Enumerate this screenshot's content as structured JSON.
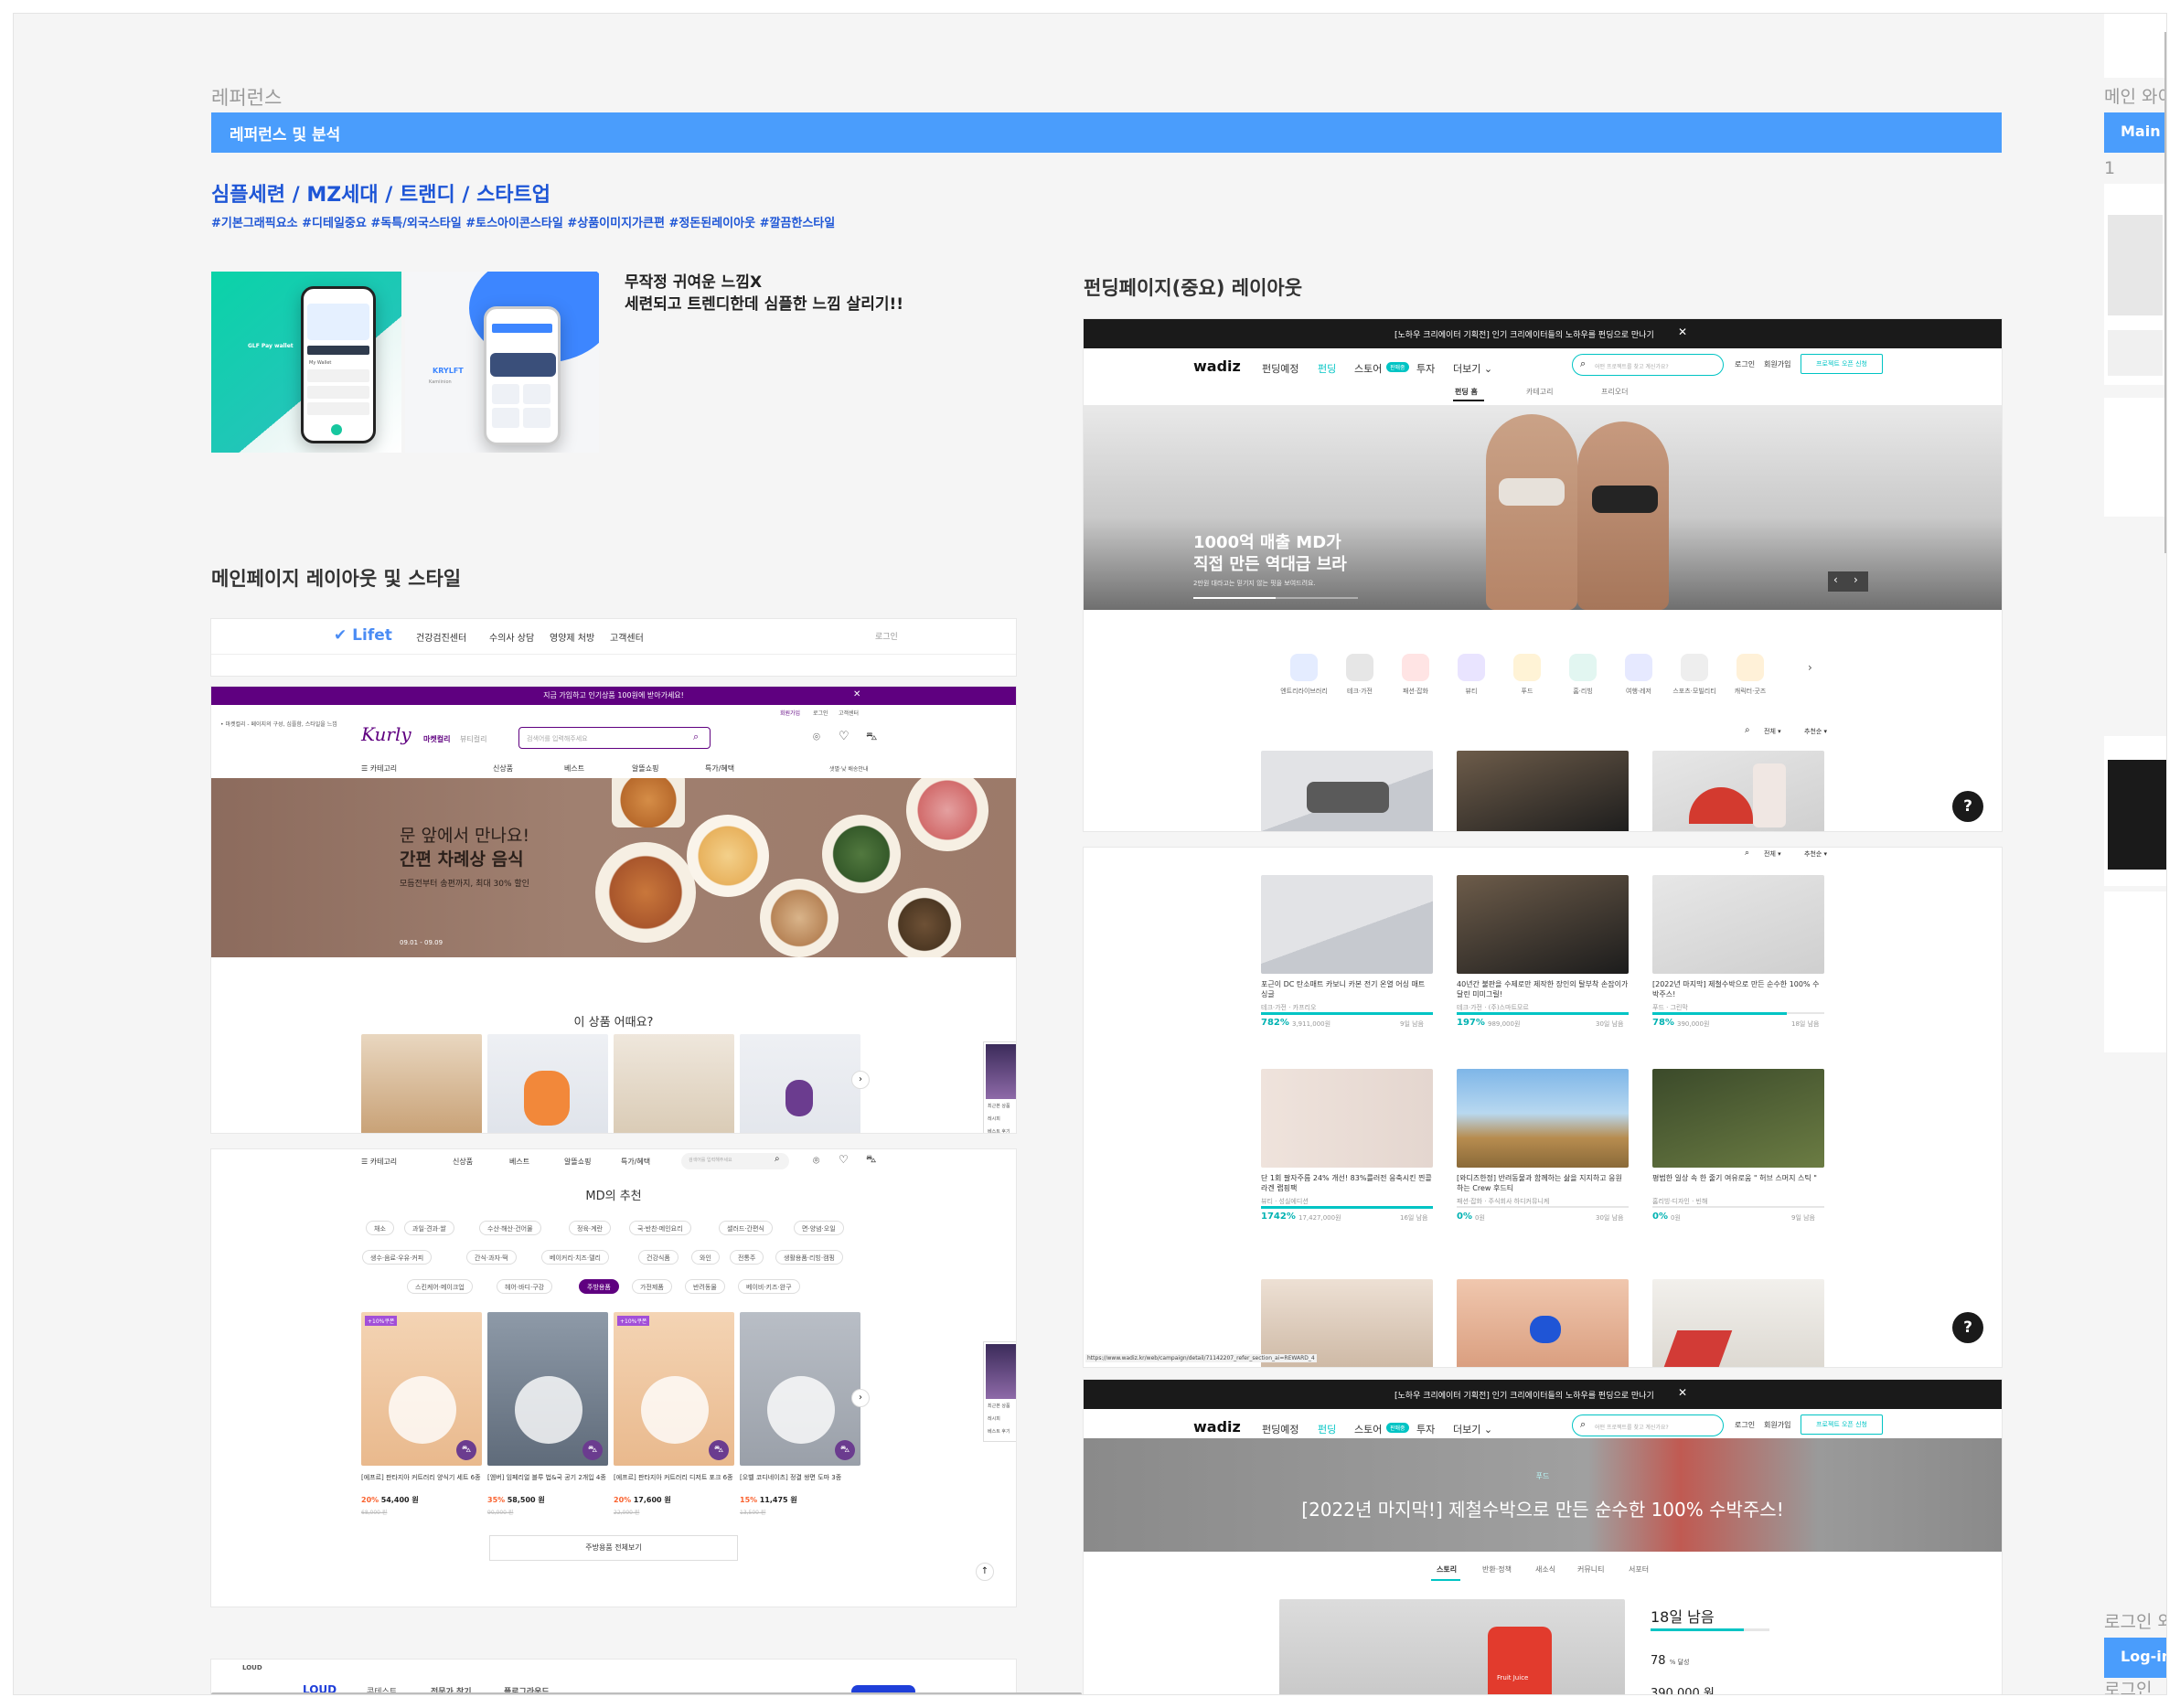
{
  "section": {
    "title_small": "레퍼런스",
    "header_bar_label": "레퍼런스 및 분석",
    "keywords": "심플세련 / MZ세대 / 트랜디 / 스타트업",
    "hashtags": "#기본그래픽요소 #디테일중요 #독특/외국스타일 #토스아이콘스타일 #상품이미지가큰편 #정돈된레이아웃 #깔끔한스타일",
    "note_line1": "무작정 귀여운 느낌X",
    "note_line2": "세련되고 트렌디한데 심플한 느낌 살리기!!",
    "main_layout_title": "메인페이지 레이아웃 및 스타일",
    "funding_layout_title": "펀딩페이지(중요) 레이아웃"
  },
  "right_panel": {
    "title": "메인 와이어",
    "bar_label": "Main Wi",
    "number": "1",
    "login_title": "로그인 와이",
    "login_bar": "Log-in W",
    "login_small": "로그인"
  },
  "phone_mockups": {
    "left": {
      "label": "GLF Pay wallet",
      "list": [
        "My Wallet",
        "Collections",
        "Expiring"
      ]
    },
    "right": {
      "brand": "KRYLFT",
      "label": "Kamiinion"
    }
  },
  "lifet": {
    "logo": "Lifet",
    "nav": [
      "건강검진센터",
      "수의사 상담",
      "영양제 처방",
      "고객센터"
    ],
    "login": "로그인"
  },
  "kurly": {
    "banner": "지금 가입하고 인기상품 100원에 받아가세요!",
    "top_links": [
      "회원가입",
      "로그인",
      "고객센터"
    ],
    "delivery_note": "• 마켓컬리 - 페이지의 구성, 심플함, 스타일을 느낌",
    "logo": "Kurly",
    "logo_sub": "마켓컬리",
    "logo_sub2": "뷰티컬리",
    "search_placeholder": "검색어를 입력해주세요",
    "menu": [
      "카테고리",
      "신상품",
      "베스트",
      "알뜰쇼핑",
      "특가/혜택"
    ],
    "delivery_info": "샛별·낮 배송안내",
    "hero_line1": "문 앞에서 만나요!",
    "hero_line2": "간편 차례상 음식",
    "hero_sub": "모듬전부터 송편까지, 최대 30% 할인",
    "hero_date": "09.01 - 09.09",
    "recommend_title": "이 상품 어때요?",
    "side_label": [
      "샛별·낮",
      "배송 안내",
      "최근본 상품",
      "레시피",
      "베스트 후기"
    ],
    "md_title": "MD의 추천",
    "md_tabs_row1": [
      "채소",
      "과일·견과·쌀",
      "수산·해산·건어물",
      "정육·계란",
      "국·반찬·메인요리",
      "샐러드·간편식",
      "면·양념·오일"
    ],
    "md_tabs_row2": [
      "생수·음료·우유·커피",
      "간식·과자·떡",
      "베이커리·치즈·델리",
      "건강식품",
      "와인",
      "전통주",
      "생활용품·리빙·캠핑"
    ],
    "md_tabs_row3": [
      "스킨케어·메이크업",
      "헤어·바디·구강",
      "주방용품",
      "가전제품",
      "반려동물",
      "베이비·키즈·완구"
    ],
    "md_active": "주방용품",
    "coupon": "+10%쿠폰",
    "products": [
      {
        "name": "[에프르] 판타지아 커트러리 양식기 세트 6종",
        "discount": "20%",
        "price": "54,400 원",
        "original": "68,000 원"
      },
      {
        "name": "[엠버] 임페리얼 블루 법&국 공기 2개입 4종",
        "discount": "35%",
        "price": "58,500 원",
        "original": "90,000 원"
      },
      {
        "name": "[에프르] 판타지아 커트러리 디저트 포크 6종",
        "discount": "20%",
        "price": "17,600 원",
        "original": "22,000 원"
      },
      {
        "name": "[오벨 코디네이츠] 정결 쌍면 도마 3종",
        "discount": "15%",
        "price": "11,475 원",
        "original": "13,500 원"
      }
    ],
    "view_all": "주방용품 전체보기"
  },
  "wadiz": {
    "banner": "[노하우 크리에이터 기획전] 인기 크리에이터들의 노하우를 펀딩으로 만나기",
    "logo": "wadiz",
    "nav": [
      "펀딩예정",
      "펀딩",
      "스토어",
      "투자",
      "더보기"
    ],
    "store_badge": "판매중",
    "search_placeholder": "어떤 프로젝트를 찾고 계신가요?",
    "login": "로그인",
    "signup": "회원가입",
    "project_btn": "프로젝트 오픈 신청",
    "subtabs": [
      "펀딩 홈",
      "카테고리",
      "프리오더"
    ],
    "hero_line1": "1000억 매출 MD가",
    "hero_line2": "직접 만든 역대급 브라",
    "hero_sub": "2만원 대라고는 믿기지 않는 핏을 보여드려요.",
    "categories": [
      "엔트리라이브러리",
      "테크·가전",
      "패션·잡화",
      "뷰티",
      "푸드",
      "홈·리빙",
      "여행·레저",
      "스포츠·모빌리티",
      "캐릭터·굿즈"
    ],
    "filter_all": "전체",
    "filter_sort": "추천순",
    "cards_row1": [
      {
        "title": "포근이 DC 탄소매트 카보니 카본 전기 온열 어싱 매트 싱글",
        "maker": "테크·가전 · 카프리오",
        "pct": "782%",
        "amount": "3,911,000원",
        "days": "9일 남음"
      },
      {
        "title": "40년간 불판을 수제로만 제작한 장인의 탈부착 손잡이가 달린 미미그릴!",
        "maker": "테크·가전 · (주)스마트모르",
        "pct": "197%",
        "amount": "989,000원",
        "days": "30일 남음"
      },
      {
        "title": "[2022년 마지막] 제철수박으로 만든 순수한 100% 수박주스!",
        "maker": "푸드 · 그린막",
        "pct": "78%",
        "amount": "390,000원",
        "days": "18일 남음"
      }
    ],
    "cards_row2": [
      {
        "title": "단 1회 팔자주름 24% 개선! 83%를러전 응축시킨 찐콜라겐 랩핑팩",
        "maker": "뷰티 · 성실에디션",
        "pct": "1742%",
        "amount": "17,427,000원",
        "days": "16일 남음"
      },
      {
        "title": "[와디즈한정] 반려동물과 함께하는 삶을 지지하고 응원하는 Crew 후드티",
        "maker": "패션·잡화 · 주식회사 하디커뮤니케",
        "pct": "0%",
        "amount": "0원",
        "days": "30일 남음"
      },
      {
        "title": "평범한 일상 속 한 줄기 여유로움 \" 허브 스머지 스틱 \"",
        "maker": "홈리빙·디자인 · 빈해",
        "pct": "0%",
        "amount": "0원",
        "days": "9일 남음"
      }
    ],
    "url_hint": "https://www.wadiz.kr/web/campaign/detail/71142207_refer_section_ai=REWARD_4",
    "detail_category": "푸드",
    "detail_title": "[2022년 마지막!] 제철수박으로 만든 순수한 100% 수박주스!",
    "detail_tabs": [
      "스토리",
      "반환·정책",
      "새소식",
      "커뮤니티",
      "서포터"
    ],
    "detail_remaining": "18일 남음",
    "detail_pct": "78",
    "detail_pct_unit": "% 달성",
    "detail_amount": "390,000 원",
    "juice_label": "Fruit Juice"
  },
  "loud": {
    "logo": "LOUD",
    "nav": [
      "콘테스트",
      "전문가 찾기",
      "플로그라운드"
    ]
  },
  "help_icon": "?",
  "colors": {
    "accent_blue": "#4a9dfc",
    "keyword_blue": "#1e56d6",
    "kurly_purple": "#5f0080",
    "wadiz_teal": "#00c4c4",
    "dark_banner": "#1a1a1a"
  }
}
